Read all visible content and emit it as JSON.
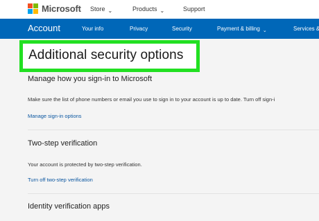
{
  "brand": {
    "name": "Microsoft",
    "colors": [
      "#f25022",
      "#7fba00",
      "#00a4ef",
      "#ffb900"
    ]
  },
  "topnav": {
    "store": "Store",
    "products": "Products",
    "support": "Support"
  },
  "account_nav": {
    "title": "Account",
    "items": [
      "Your info",
      "Privacy",
      "Security",
      "Payment & billing",
      "Services &"
    ]
  },
  "page": {
    "title": "Additional security options",
    "sections": [
      {
        "heading": "Manage how you sign-in to Microsoft",
        "text": "Make sure the list of phone numbers or email you use to sign in to your account is up to date. Turn off sign-i",
        "link": "Manage sign-in options"
      },
      {
        "heading": "Two-step verification",
        "text": "Your account is protected by two-step verification.",
        "link": "Turn off two-step verification"
      },
      {
        "heading": "Identity verification apps"
      }
    ]
  },
  "colors": {
    "accent": "#0067b8",
    "highlight": "#22e022",
    "link": "#0a56a0"
  }
}
